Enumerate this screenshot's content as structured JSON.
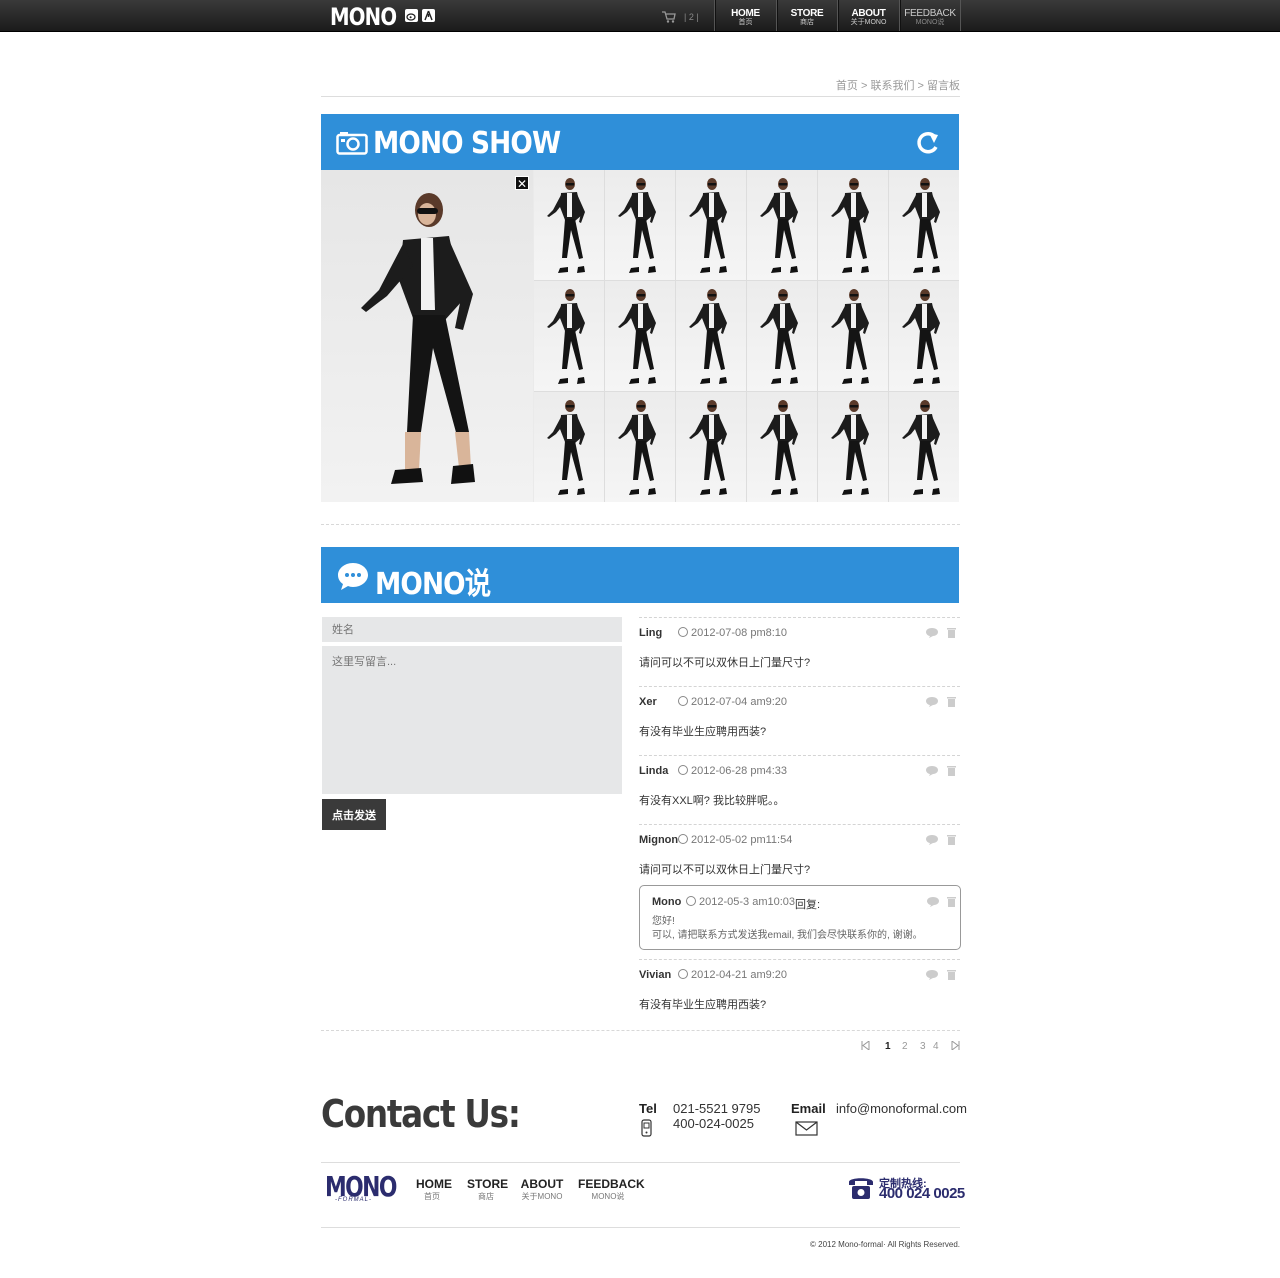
{
  "brand": {
    "logo": "MONO",
    "accent_color": "#2f8fd9",
    "dark_color": "#2b2c6e"
  },
  "topbar": {
    "cart_count": "| 2 |",
    "nav": [
      {
        "en": "HOME",
        "zh": "首页"
      },
      {
        "en": "STORE",
        "zh": "商店"
      },
      {
        "en": "ABOUT",
        "zh": "关于MONO"
      },
      {
        "en": "FEEDBACK",
        "zh": "MONO说"
      }
    ]
  },
  "breadcrumb": "首页 > 联系我们 > 留言板",
  "gallery": {
    "title": "MONO SHOW"
  },
  "messages": {
    "title": "MONO说",
    "form": {
      "name_placeholder": "姓名",
      "message_placeholder": "这里写留言...",
      "submit_label": "点击发送"
    },
    "comments": [
      {
        "author": "Ling",
        "time": "2012-07-08  pm8:10",
        "text": "请问可以不可以双休日上门量尺寸?"
      },
      {
        "author": "Xer",
        "time": "2012-07-04  am9:20",
        "text": "有没有毕业生应聘用西装?"
      },
      {
        "author": "Linda",
        "time": "2012-06-28  pm4:33",
        "text": "有没有XXL啊? 我比较胖呢。。"
      },
      {
        "author": "Mignon",
        "time": "2012-05-02  pm11:54",
        "text": "请问可以不可以双休日上门量尺寸?"
      },
      {
        "author": "Vivian",
        "time": "2012-04-21  am9:20",
        "text": "有没有毕业生应聘用西装?"
      }
    ],
    "reply": {
      "author": "Mono",
      "time": "2012-05-3  am10:03",
      "label": "回复:",
      "line1": "您好!",
      "line2": "可以, 请把联系方式发送我email, 我们会尽快联系你的, 谢谢。"
    }
  },
  "pagination": [
    "1",
    "2",
    "3",
    "4"
  ],
  "contact": {
    "title": "Contact Us:",
    "tel_label": "Tel",
    "tel1": "021-5521 9795",
    "tel2": "400-024-0025",
    "email_label": "Email",
    "email": "info@monoformal.com"
  },
  "footer": {
    "logo": "MONO",
    "logo_sub": "-FORMAL-",
    "nav": [
      {
        "en": "HOME",
        "zh": "首页"
      },
      {
        "en": "STORE",
        "zh": "商店"
      },
      {
        "en": "ABOUT",
        "zh": "关于MONO"
      },
      {
        "en": "FEEDBACK",
        "zh": "MONO说"
      }
    ],
    "hotline_label": "定制热线:",
    "hotline": "400 024 0025",
    "copyright": "© 2012  Mono-formal· All Rights Reserved."
  }
}
